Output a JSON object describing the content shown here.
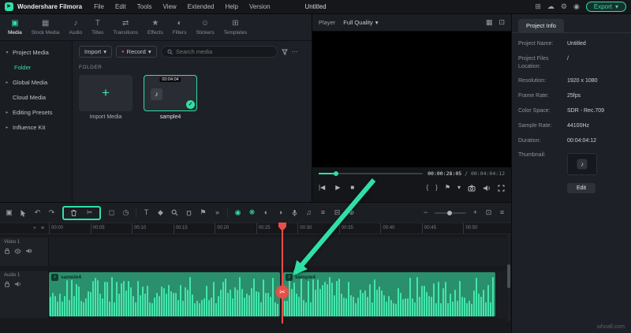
{
  "titlebar": {
    "app_name": "Wondershare Filmora",
    "menus": [
      "File",
      "Edit",
      "Tools",
      "View",
      "Extended",
      "Help",
      "Version"
    ],
    "project_title": "Untitled",
    "export_label": "Export"
  },
  "media_tabs": [
    {
      "label": "Media",
      "icon": "▣"
    },
    {
      "label": "Stock Media",
      "icon": "▦"
    },
    {
      "label": "Audio",
      "icon": "♪"
    },
    {
      "label": "Titles",
      "icon": "T"
    },
    {
      "label": "Transitions",
      "icon": "⇄"
    },
    {
      "label": "Effects",
      "icon": "★"
    },
    {
      "label": "Filters",
      "icon": "◐"
    },
    {
      "label": "Stickers",
      "icon": "☺"
    },
    {
      "label": "Templates",
      "icon": "⊞"
    }
  ],
  "sidebar": {
    "items": [
      {
        "label": "Project Media",
        "chevron": "▾"
      },
      {
        "label": "Folder",
        "chevron": ""
      },
      {
        "label": "Global Media",
        "chevron": "▸"
      },
      {
        "label": "Cloud Media",
        "chevron": ""
      },
      {
        "label": "Editing Presets",
        "chevron": "▸"
      },
      {
        "label": "Influence Kit",
        "chevron": "▸"
      }
    ]
  },
  "browser": {
    "import_button": "Import",
    "record_button": "Record",
    "search_placeholder": "Search media",
    "section_label": "FOLDER",
    "import_tile_label": "Import Media",
    "clip_name": "sample4",
    "clip_duration": "00:04:04"
  },
  "player": {
    "label": "Player",
    "quality": "Full Quality",
    "current_time": "00:00:28:05",
    "divider": "/",
    "total_time": "00:04:04:12"
  },
  "project_info": {
    "tab_label": "Project Info",
    "fields": [
      {
        "label": "Project Name:",
        "value": "Untitled"
      },
      {
        "label": "Project Files Location:",
        "value": "/"
      },
      {
        "label": "Resolution:",
        "value": "1920 x 1080"
      },
      {
        "label": "Frame Rate:",
        "value": "25fps"
      },
      {
        "label": "Color Space:",
        "value": "SDR - Rec.709"
      },
      {
        "label": "Sample Rate:",
        "value": "44100Hz"
      },
      {
        "label": "Duration:",
        "value": "00:04:04:12"
      }
    ],
    "thumbnail_label": "Thumbnail:",
    "edit_button": "Edit"
  },
  "timeline": {
    "ruler_ticks": [
      "00:00",
      "00:05",
      "00:10",
      "00:15",
      "00:20",
      "00:25",
      "00:30",
      "00:35",
      "00:40",
      "00:45",
      "00:50"
    ],
    "tracks": [
      {
        "name": "Video 1"
      },
      {
        "name": "Audio 1"
      }
    ],
    "segments": [
      {
        "label": "sample4"
      },
      {
        "label": "sample4"
      }
    ]
  },
  "watermark": "whoall.com",
  "icons": {
    "logo_play": "▶",
    "chevron_down": "▾",
    "chevron_right": "▸",
    "ellipsis": "⋯",
    "plus": "+",
    "music_note": "♪",
    "check": "✓",
    "record_dot": "●",
    "apps_grid": "⊞",
    "cloud": "☁",
    "gear": "⚙",
    "account": "◉",
    "grid_view": "▦",
    "pop_out": "⊡",
    "prev_frame": "|◀",
    "play": "▶",
    "stop": "■",
    "bracket_in": "{",
    "bracket_out": "}",
    "flag": "⚑",
    "media_layers": "▣",
    "undo": "↶",
    "redo": "↷",
    "split_scissors": "✂",
    "crop": "◻",
    "speed_clock": "◷",
    "text_tool": "T",
    "keyframe": "◆",
    "magnet": "Ω",
    "more_chevrons": "»",
    "render_preview": "◉",
    "ai_flower": "❋",
    "mask": "◐",
    "chroma": "◑",
    "voice": "♫",
    "mixer": "≡",
    "screen_rec": "⊟",
    "sync": "⊕",
    "minus": "−",
    "fit_view": "⊡",
    "track_manage": "≡"
  },
  "colors": {
    "accent": "#2FE0A6",
    "playhead_red": "#E84F48",
    "clip_teal": "#2A8F6D",
    "waveform": "#43E6AB"
  }
}
